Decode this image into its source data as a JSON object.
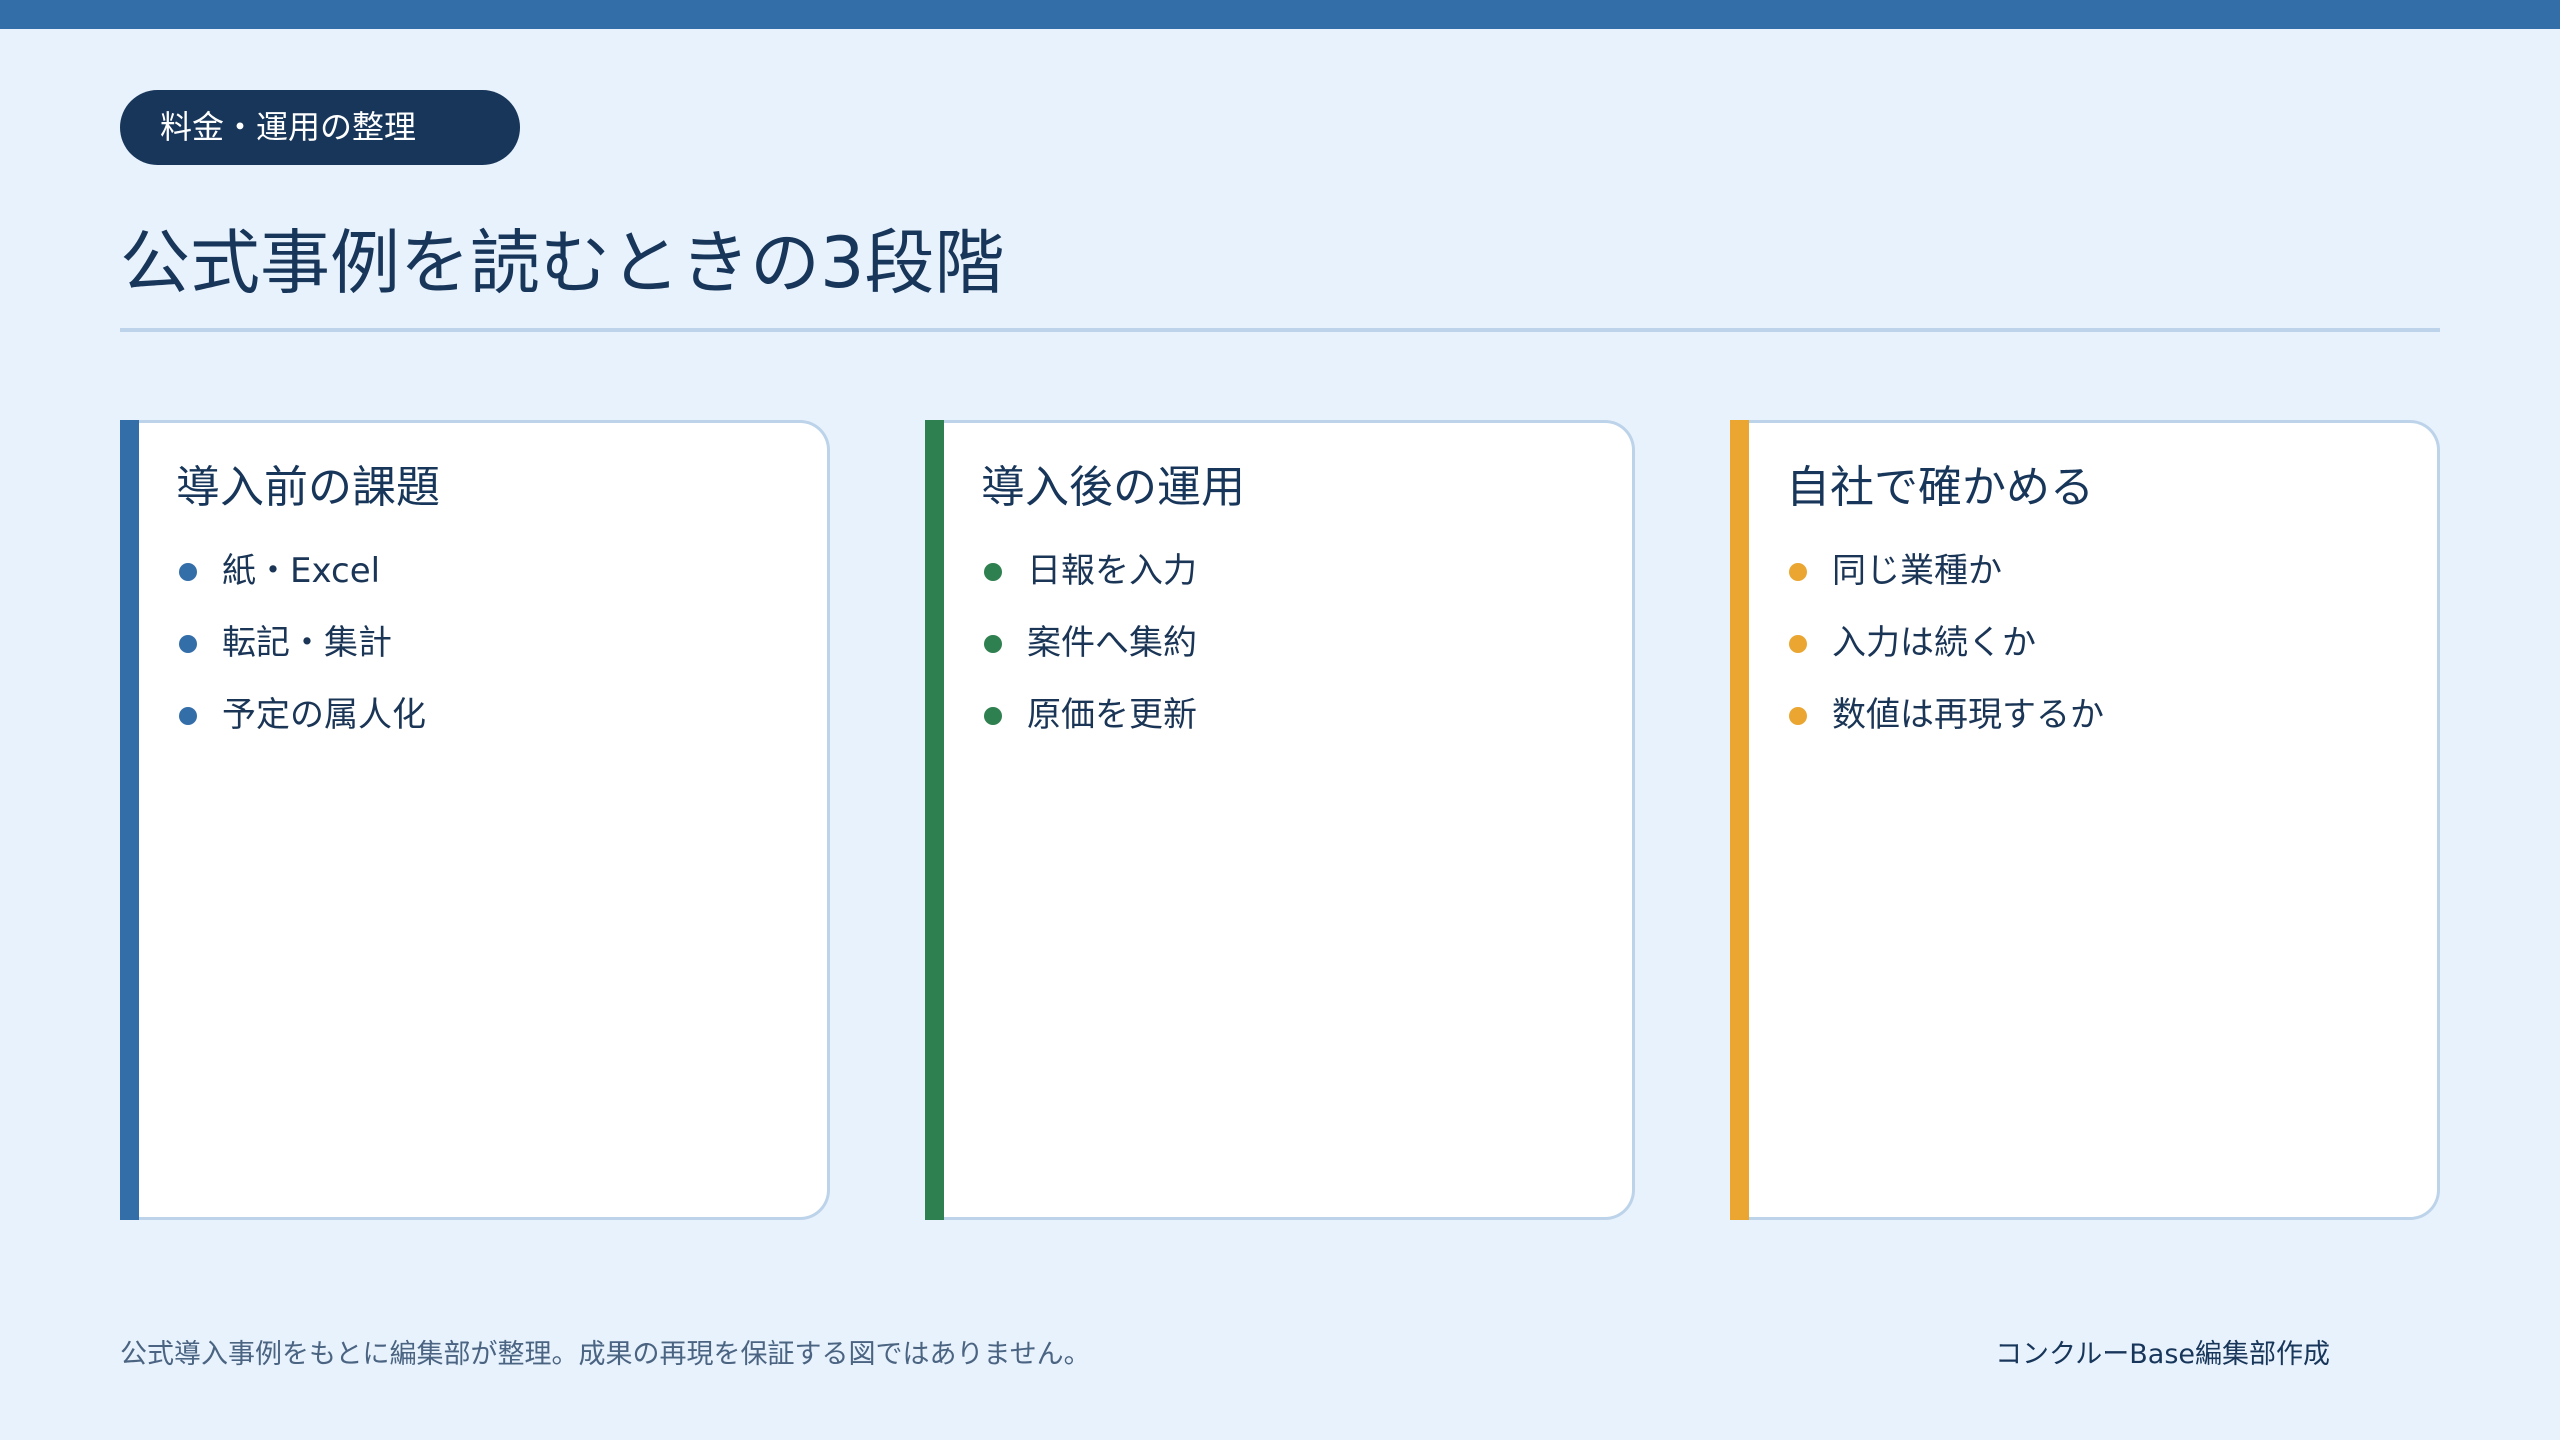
{
  "header": {
    "tag": "料金・運用の整理",
    "title": "公式事例を読むときの3段階"
  },
  "colors": {
    "topbar": "#336ea8",
    "navy": "#17365a",
    "blue": "#336ea8",
    "green": "#2e8050",
    "orange": "#eaa631",
    "background": "#e8f2fc"
  },
  "cards": [
    {
      "title": "導入前の課題",
      "accent": "#336ea8",
      "items": [
        "紙・Excel",
        "転記・集計",
        "予定の属人化"
      ]
    },
    {
      "title": "導入後の運用",
      "accent": "#2e8050",
      "items": [
        "日報を入力",
        "案件へ集約",
        "原価を更新"
      ]
    },
    {
      "title": "自社で確かめる",
      "accent": "#eaa631",
      "items": [
        "同じ業種か",
        "入力は続くか",
        "数値は再現するか"
      ]
    }
  ],
  "footer": {
    "note": "公式導入事例をもとに編集部が整理。成果の再現を保証する図ではありません。",
    "credit": "コンクルーBase編集部作成"
  }
}
